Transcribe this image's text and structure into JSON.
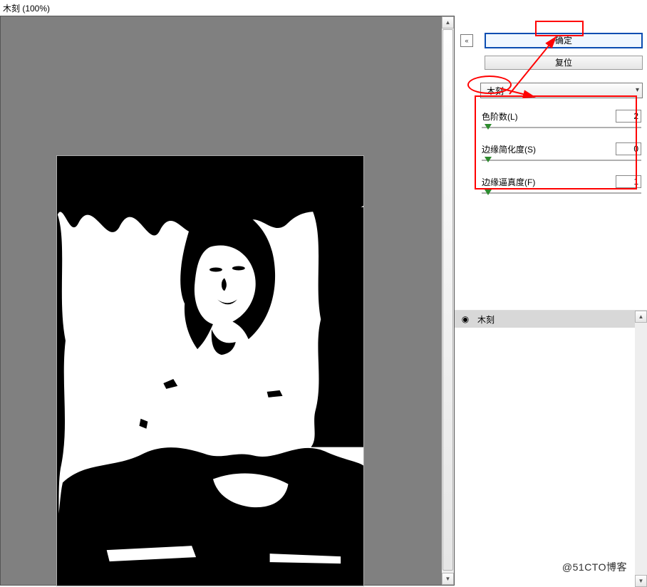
{
  "title": "木刻 (100%)",
  "buttons": {
    "ok": "确定",
    "reset": "复位"
  },
  "filter_dropdown": {
    "selected": "木刻"
  },
  "params": {
    "levels": {
      "label": "色阶数(L)",
      "value": "2",
      "thumb_pct": 2
    },
    "simplify": {
      "label": "边缘简化度(S)",
      "value": "0",
      "thumb_pct": 2
    },
    "fidelity": {
      "label": "边缘逼真度(F)",
      "value": "1",
      "thumb_pct": 2
    }
  },
  "layers": {
    "item": "木刻"
  },
  "icons": {
    "rollup": "«",
    "chevron_down": "▾",
    "scroll_up": "▲",
    "scroll_down": "▼",
    "eye": "◉"
  },
  "watermark": "@51CTO博客"
}
